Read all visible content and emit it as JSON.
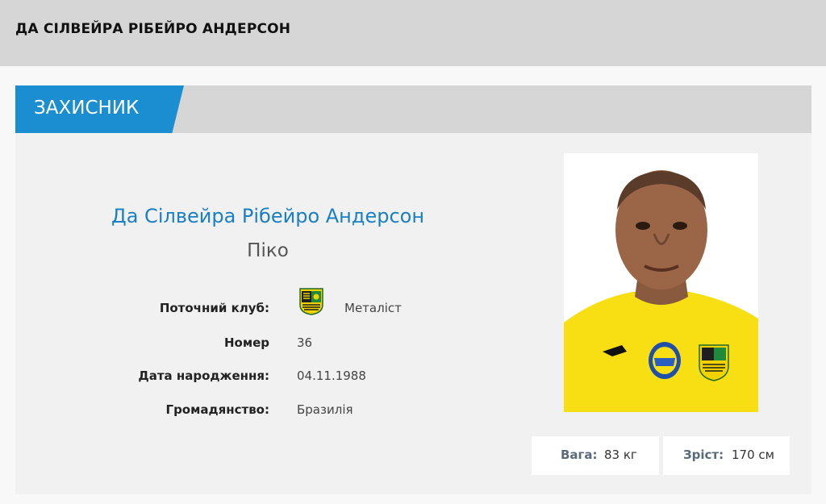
{
  "page": {
    "title": "ДА СІЛВЕЙРА РІБЕЙРО АНДЕРСОН"
  },
  "card": {
    "position": "ЗАХИСНИК",
    "accent_color": "#1a8ed0",
    "player": {
      "full_name": "Да Сілвейра Рібейро Андерсон",
      "nickname": "Піко"
    },
    "info": [
      {
        "label": "Поточний клуб:",
        "value": "Металіст",
        "icon": "club-logo-icon"
      },
      {
        "label": "Номер",
        "value": "36"
      },
      {
        "label": "Дата народження:",
        "value": "04.11.1988"
      },
      {
        "label": "Громадянство:",
        "value": "Бразилія"
      }
    ],
    "stats": {
      "weight_label": "Вага:",
      "weight_value": "83 кг",
      "height_label": "Зріст:",
      "height_value": "170 см"
    }
  }
}
